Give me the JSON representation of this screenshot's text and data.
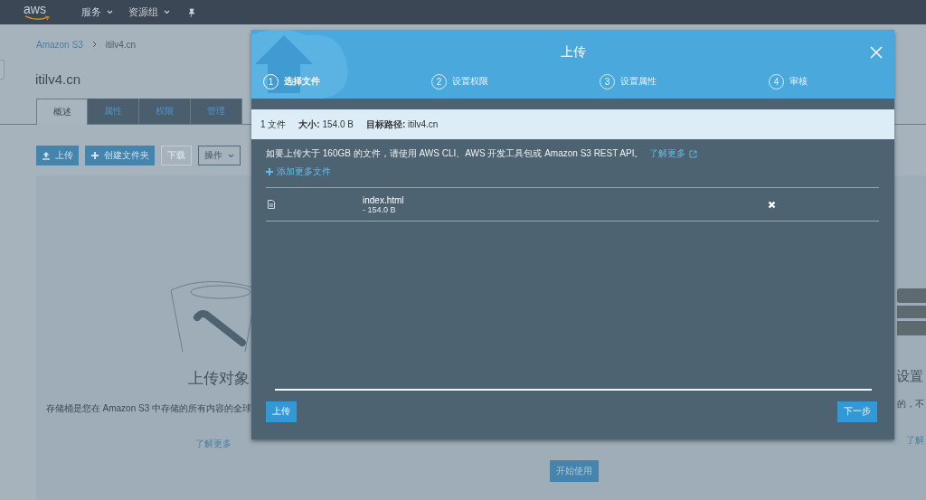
{
  "top_nav": {
    "logo": "aws",
    "menus": [
      {
        "label": "服务"
      },
      {
        "label": "资源组"
      }
    ]
  },
  "breadcrumb": [
    "Amazon S3",
    "itilv4.cn"
  ],
  "page_title": "itilv4.cn",
  "tabs": [
    {
      "label": "概述",
      "selected": true
    },
    {
      "label": "属性",
      "selected": false
    },
    {
      "label": "权限",
      "selected": false
    },
    {
      "label": "管理",
      "selected": false
    }
  ],
  "toolbar": [
    {
      "label": "上传",
      "kind": "upload",
      "disabled": false
    },
    {
      "label": "创建文件夹",
      "kind": "add",
      "disabled": false
    },
    {
      "label": "下载",
      "kind": "plain",
      "disabled": true
    },
    {
      "label": "操作",
      "kind": "menu",
      "disabled": false
    }
  ],
  "cards": [
    {
      "kind": "bucket",
      "title": "上传对象",
      "text": "存储桶是您在 Amazon S3 中存储的所有内容的全球",
      "link": "了解更多"
    },
    {
      "kind": "start",
      "button": "开始使用"
    },
    {
      "kind": "database",
      "title": "设置",
      "text": "的，不",
      "link": "了解"
    }
  ],
  "dialog": {
    "title": "上传",
    "steps": [
      {
        "number": "1",
        "label": "选择文件",
        "selected": true
      },
      {
        "number": "2",
        "label": "设置权限",
        "selected": false
      },
      {
        "number": "3",
        "label": "设置属性",
        "selected": false
      },
      {
        "number": "4",
        "label": "审核",
        "selected": false
      }
    ],
    "summary": [
      "1 文件",
      "**大小:** 154.0 B",
      "**目标路径:** itilv4.cn"
    ],
    "notice": "如要上传大于 160GB 的文件，请使用 AWS CLI、AWS 开发工具包或 Amazon S3 REST API。",
    "notice_link": "了解更多",
    "add_files": "添加更多文件",
    "files": [
      {
        "name": "index.html",
        "size": "- 154.0 B"
      }
    ],
    "buttons": [
      {
        "label": "上传"
      },
      {
        "label": "下一步"
      }
    ]
  }
}
